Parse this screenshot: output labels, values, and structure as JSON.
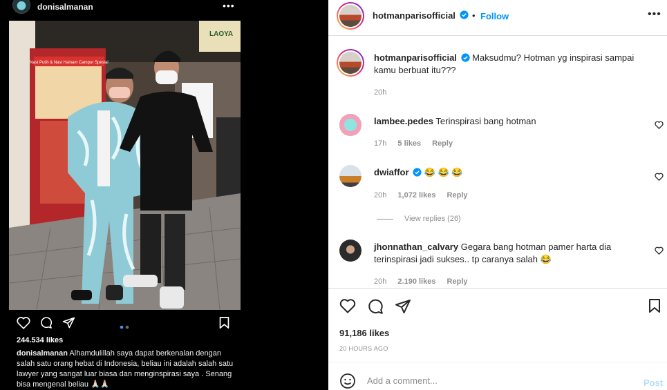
{
  "left": {
    "username": "donisalmanan",
    "more": "•••",
    "likes": "244.534 likes",
    "caption_user": "donisalmanan",
    "caption_text": "Alhamdulillah saya dapat berkenalan dengan salah satu orang hebat di Indonesia, beliau ini adalah salah satu lawyer yang sangat luar biasa dan menginspirasi saya . Senang bisa mengenal beliau 🙏🏻🙏🏻",
    "shop_sign": "Nasi Putih & Nasi Hainam Campur Spesial",
    "shop_sign2": "LAOYA",
    "carousel": {
      "total": 2,
      "active": 0
    }
  },
  "post": {
    "username": "hotmanparisofficial",
    "follow_label": "Follow",
    "more": "•••",
    "caption_text": "Maksudmu? Hotman yg inspirasi sampai kamu berbuat itu???",
    "caption_time": "20h"
  },
  "comments": [
    {
      "user": "lambee.pedes",
      "text": "Terinspirasi bang hotman",
      "time": "17h",
      "likes": "5 likes",
      "reply": "Reply"
    },
    {
      "user": "dwiaffor",
      "text": "😂 😂 😂",
      "time": "20h",
      "likes": "1,072 likes",
      "reply": "Reply",
      "view_replies": "View replies (26)"
    },
    {
      "user": "jhonnathan_calvary",
      "text": "Gegara bang hotman pamer harta dia terinspirasi jadi sukses.. tp caranya salah 😂",
      "time": "20h",
      "likes": "2.190 likes",
      "reply": "Reply"
    }
  ],
  "footer": {
    "likes": "91,186 likes",
    "timestamp": "20 HOURS AGO",
    "comment_placeholder": "Add a comment...",
    "post_label": "Post"
  },
  "colors": {
    "accent": "#0095f6",
    "muted": "#8e8e8e",
    "border": "#dbdbdb"
  }
}
